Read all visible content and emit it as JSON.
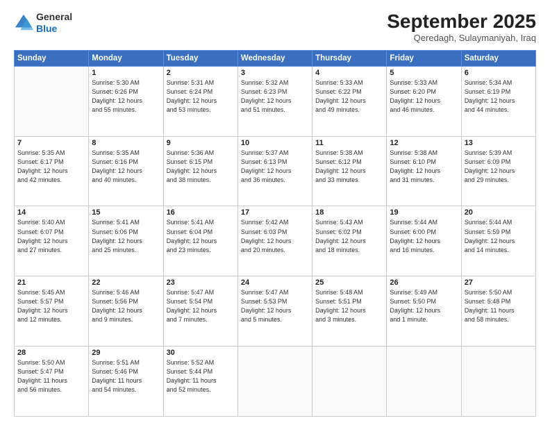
{
  "header": {
    "logo_general": "General",
    "logo_blue": "Blue",
    "month_title": "September 2025",
    "subtitle": "Qeredagh, Sulaymaniyah, Iraq"
  },
  "weekdays": [
    "Sunday",
    "Monday",
    "Tuesday",
    "Wednesday",
    "Thursday",
    "Friday",
    "Saturday"
  ],
  "weeks": [
    [
      {
        "day": "",
        "info": ""
      },
      {
        "day": "1",
        "info": "Sunrise: 5:30 AM\nSunset: 6:26 PM\nDaylight: 12 hours\nand 55 minutes."
      },
      {
        "day": "2",
        "info": "Sunrise: 5:31 AM\nSunset: 6:24 PM\nDaylight: 12 hours\nand 53 minutes."
      },
      {
        "day": "3",
        "info": "Sunrise: 5:32 AM\nSunset: 6:23 PM\nDaylight: 12 hours\nand 51 minutes."
      },
      {
        "day": "4",
        "info": "Sunrise: 5:33 AM\nSunset: 6:22 PM\nDaylight: 12 hours\nand 49 minutes."
      },
      {
        "day": "5",
        "info": "Sunrise: 5:33 AM\nSunset: 6:20 PM\nDaylight: 12 hours\nand 46 minutes."
      },
      {
        "day": "6",
        "info": "Sunrise: 5:34 AM\nSunset: 6:19 PM\nDaylight: 12 hours\nand 44 minutes."
      }
    ],
    [
      {
        "day": "7",
        "info": "Sunrise: 5:35 AM\nSunset: 6:17 PM\nDaylight: 12 hours\nand 42 minutes."
      },
      {
        "day": "8",
        "info": "Sunrise: 5:35 AM\nSunset: 6:16 PM\nDaylight: 12 hours\nand 40 minutes."
      },
      {
        "day": "9",
        "info": "Sunrise: 5:36 AM\nSunset: 6:15 PM\nDaylight: 12 hours\nand 38 minutes."
      },
      {
        "day": "10",
        "info": "Sunrise: 5:37 AM\nSunset: 6:13 PM\nDaylight: 12 hours\nand 36 minutes."
      },
      {
        "day": "11",
        "info": "Sunrise: 5:38 AM\nSunset: 6:12 PM\nDaylight: 12 hours\nand 33 minutes."
      },
      {
        "day": "12",
        "info": "Sunrise: 5:38 AM\nSunset: 6:10 PM\nDaylight: 12 hours\nand 31 minutes."
      },
      {
        "day": "13",
        "info": "Sunrise: 5:39 AM\nSunset: 6:09 PM\nDaylight: 12 hours\nand 29 minutes."
      }
    ],
    [
      {
        "day": "14",
        "info": "Sunrise: 5:40 AM\nSunset: 6:07 PM\nDaylight: 12 hours\nand 27 minutes."
      },
      {
        "day": "15",
        "info": "Sunrise: 5:41 AM\nSunset: 6:06 PM\nDaylight: 12 hours\nand 25 minutes."
      },
      {
        "day": "16",
        "info": "Sunrise: 5:41 AM\nSunset: 6:04 PM\nDaylight: 12 hours\nand 23 minutes."
      },
      {
        "day": "17",
        "info": "Sunrise: 5:42 AM\nSunset: 6:03 PM\nDaylight: 12 hours\nand 20 minutes."
      },
      {
        "day": "18",
        "info": "Sunrise: 5:43 AM\nSunset: 6:02 PM\nDaylight: 12 hours\nand 18 minutes."
      },
      {
        "day": "19",
        "info": "Sunrise: 5:44 AM\nSunset: 6:00 PM\nDaylight: 12 hours\nand 16 minutes."
      },
      {
        "day": "20",
        "info": "Sunrise: 5:44 AM\nSunset: 5:59 PM\nDaylight: 12 hours\nand 14 minutes."
      }
    ],
    [
      {
        "day": "21",
        "info": "Sunrise: 5:45 AM\nSunset: 5:57 PM\nDaylight: 12 hours\nand 12 minutes."
      },
      {
        "day": "22",
        "info": "Sunrise: 5:46 AM\nSunset: 5:56 PM\nDaylight: 12 hours\nand 9 minutes."
      },
      {
        "day": "23",
        "info": "Sunrise: 5:47 AM\nSunset: 5:54 PM\nDaylight: 12 hours\nand 7 minutes."
      },
      {
        "day": "24",
        "info": "Sunrise: 5:47 AM\nSunset: 5:53 PM\nDaylight: 12 hours\nand 5 minutes."
      },
      {
        "day": "25",
        "info": "Sunrise: 5:48 AM\nSunset: 5:51 PM\nDaylight: 12 hours\nand 3 minutes."
      },
      {
        "day": "26",
        "info": "Sunrise: 5:49 AM\nSunset: 5:50 PM\nDaylight: 12 hours\nand 1 minute."
      },
      {
        "day": "27",
        "info": "Sunrise: 5:50 AM\nSunset: 5:48 PM\nDaylight: 11 hours\nand 58 minutes."
      }
    ],
    [
      {
        "day": "28",
        "info": "Sunrise: 5:50 AM\nSunset: 5:47 PM\nDaylight: 11 hours\nand 56 minutes."
      },
      {
        "day": "29",
        "info": "Sunrise: 5:51 AM\nSunset: 5:46 PM\nDaylight: 11 hours\nand 54 minutes."
      },
      {
        "day": "30",
        "info": "Sunrise: 5:52 AM\nSunset: 5:44 PM\nDaylight: 11 hours\nand 52 minutes."
      },
      {
        "day": "",
        "info": ""
      },
      {
        "day": "",
        "info": ""
      },
      {
        "day": "",
        "info": ""
      },
      {
        "day": "",
        "info": ""
      }
    ]
  ]
}
